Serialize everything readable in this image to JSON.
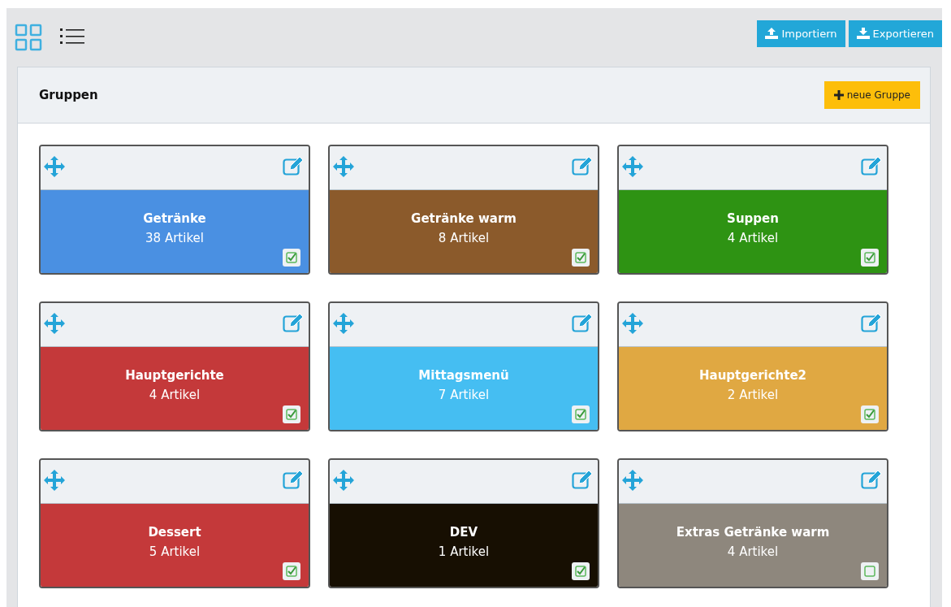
{
  "view_toggle": [
    {
      "kind": "grid",
      "selected": true
    },
    {
      "kind": "list",
      "selected": false
    }
  ],
  "toolbar_buttons": [
    {
      "kind": "import",
      "label": "Importiern"
    },
    {
      "kind": "export",
      "label": "Exportieren"
    }
  ],
  "panel": {
    "title": "Gruppen",
    "new_button": "neue Gruppe"
  },
  "groups": [
    {
      "name": "Getränke",
      "count": "38 Artikel",
      "color": "#4a90e2",
      "checked": true
    },
    {
      "name": "Getränke warm",
      "count": "8 Artikel",
      "color": "#8b5a2b",
      "checked": true
    },
    {
      "name": "Suppen",
      "count": "4 Artikel",
      "color": "#2e9313",
      "checked": true
    },
    {
      "name": "Hauptgerichte",
      "count": "4 Artikel",
      "color": "#c4393a",
      "checked": true
    },
    {
      "name": "Mittagsmenü",
      "count": "7 Artikel",
      "color": "#45bef2",
      "checked": true
    },
    {
      "name": "Hauptgerichte2",
      "count": "2 Artikel",
      "color": "#e0a842",
      "checked": true
    },
    {
      "name": "Dessert",
      "count": "5 Artikel",
      "color": "#c4393a",
      "checked": true
    },
    {
      "name": "DEV",
      "count": "1 Artikel",
      "color": "#170f02",
      "checked": true
    },
    {
      "name": "Extras Getränke warm",
      "count": "4 Artikel",
      "color": "#8e877d",
      "checked": false
    }
  ]
}
